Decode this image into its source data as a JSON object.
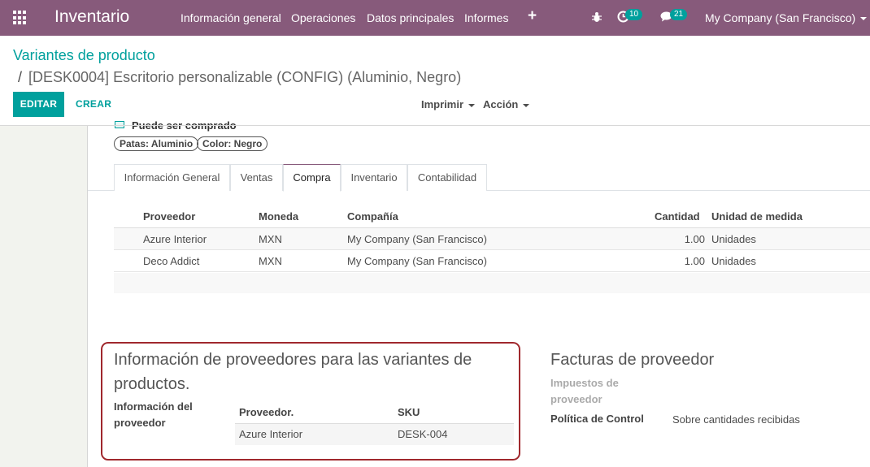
{
  "navbar": {
    "app_name": "Inventario",
    "menu": [
      "Información general",
      "Operaciones",
      "Datos principales",
      "Informes"
    ],
    "activity_count": "10",
    "message_count": "21",
    "company": "My Company (San Francisco)",
    "color": "#875a7b"
  },
  "breadcrumb": {
    "parent": "Variantes de producto",
    "separator": "/",
    "current": "[DESK0004] Escritorio personalizable (CONFIG) (Aluminio, Negro)"
  },
  "buttons": {
    "edit": "EDITAR",
    "create": "CREAR",
    "print": "Imprimir",
    "action": "Acción"
  },
  "form": {
    "cutoff_label": "Puede ser comprado",
    "tags": [
      "Patas: Aluminio",
      "Color: Negro"
    ],
    "tabs": [
      "Información General",
      "Ventas",
      "Compra",
      "Inventario",
      "Contabilidad"
    ],
    "active_tab": "Compra"
  },
  "vendor_table": {
    "columns": [
      "Proveedor",
      "Moneda",
      "Compañía",
      "Cantidad",
      "Unidad de medida"
    ],
    "rows": [
      [
        "Azure Interior",
        "MXN",
        "My Company (San Francisco)",
        "1.00",
        "Unidades"
      ],
      [
        "Deco Addict",
        "MXN",
        "My Company (San Francisco)",
        "1.00",
        "Unidades"
      ]
    ]
  },
  "variant_vendor_info": {
    "title_line1": "Información de proveedores para las variantes de",
    "title_line2": "productos.",
    "label_line1": "Información del",
    "label_line2": "proveedor",
    "columns": [
      "Proveedor.",
      "SKU"
    ],
    "rows": [
      [
        "Azure Interior",
        "DESK-004"
      ]
    ]
  },
  "vendor_bills": {
    "title": "Facturas de proveedor",
    "taxes_label_line1": "Impuestos de",
    "taxes_label_line2": "proveedor",
    "control_label": "Política de Control",
    "control_value": "Sobre cantidades recibidas"
  },
  "colors": {
    "accent": "#00a09d",
    "highlight_border": "#a0282d"
  }
}
